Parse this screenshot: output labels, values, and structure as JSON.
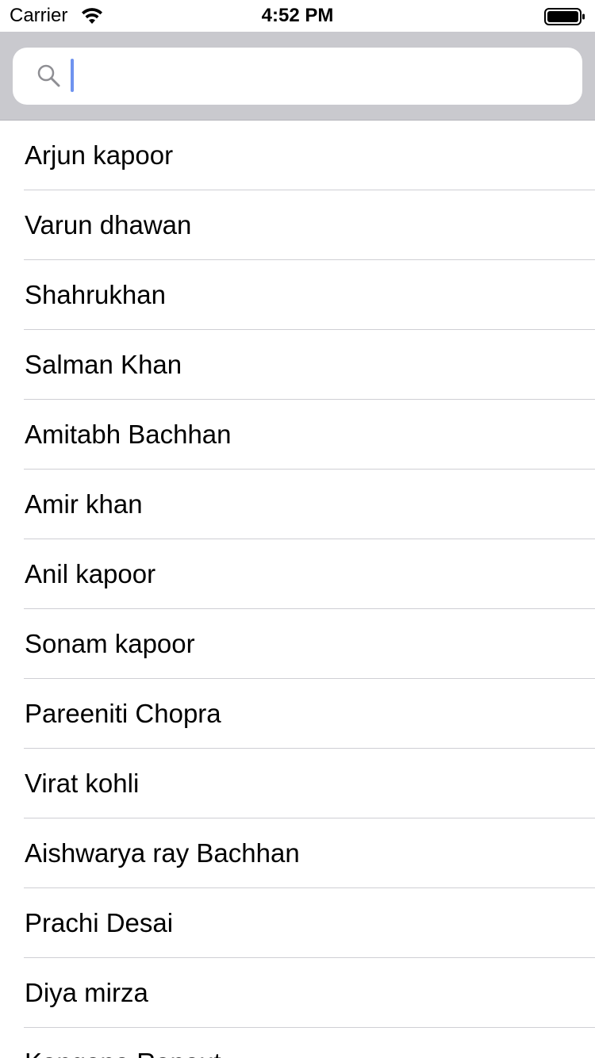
{
  "status_bar": {
    "carrier": "Carrier",
    "time": "4:52 PM",
    "wifi_icon": "wifi-icon",
    "battery_icon": "battery-full-icon"
  },
  "search": {
    "value": "",
    "placeholder": "",
    "icon": "search-icon",
    "accent_color": "#6f93ef"
  },
  "list": {
    "items": [
      "Arjun kapoor",
      "Varun dhawan",
      "Shahrukhan",
      "Salman Khan",
      "Amitabh Bachhan",
      "Amir khan",
      "Anil kapoor",
      "Sonam kapoor",
      "Pareeniti Chopra",
      "Virat kohli",
      "Aishwarya ray Bachhan",
      "Prachi Desai",
      "Diya mirza",
      "Kangana Ranaut"
    ]
  },
  "colors": {
    "search_bar_background": "#c9c9ce",
    "separator": "#cfcfd4"
  }
}
